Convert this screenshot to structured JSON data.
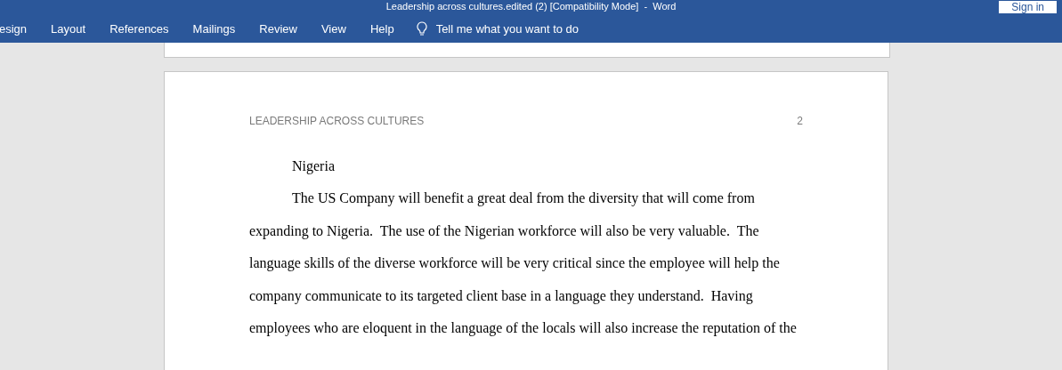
{
  "window": {
    "title": "Leadership across cultures.edited (2) [Compatibility Mode]  -  Word",
    "sign_in": "Sign in"
  },
  "ribbon_tabs": [
    "esign",
    "Layout",
    "References",
    "Mailings",
    "Review",
    "View",
    "Help"
  ],
  "tell_me": {
    "placeholder": "Tell me what you want to do"
  },
  "page": {
    "header": "LEADERSHIP ACROSS CULTURES",
    "page_number": "2",
    "heading": "Nigeria",
    "lines": [
      "The US Company will benefit a great deal from the diversity that will come from",
      "expanding to Nigeria.  The use of the Nigerian workforce will also be very valuable.  The",
      "language skills of the diverse workforce will be very critical since the employee will help the",
      "company communicate to its targeted client base in a language they understand.  Having",
      "employees who are eloquent in the language of the locals will also increase the reputation of the"
    ]
  }
}
